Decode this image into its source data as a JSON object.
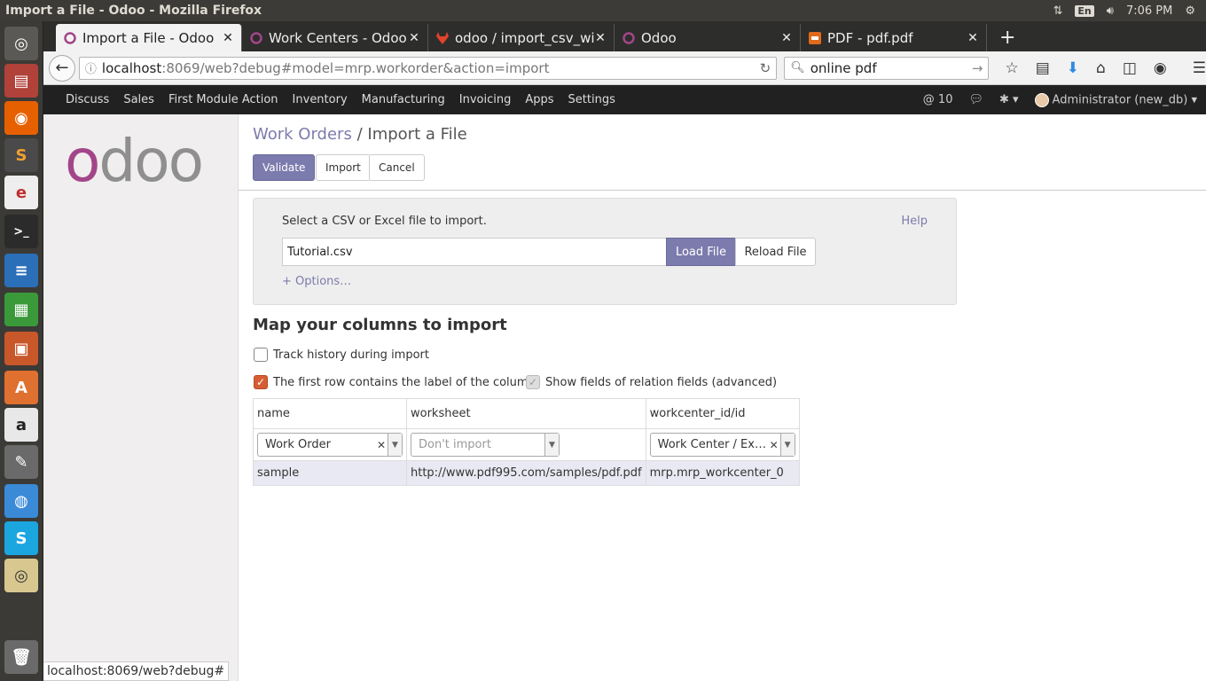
{
  "os": {
    "window_title": "Import a File - Odoo - Mozilla Firefox",
    "keyboard": "En",
    "clock": "7:06 PM"
  },
  "tabs": [
    {
      "label": "Import a File - Odoo",
      "active": true,
      "icon": "odoo-favicon"
    },
    {
      "label": "Work Centers - Odoo",
      "active": false,
      "icon": "odoo-favicon"
    },
    {
      "label": "odoo / import_csv_wit",
      "active": false,
      "icon": "gitlab-favicon"
    },
    {
      "label": "Odoo",
      "active": false,
      "icon": "odoo-favicon"
    },
    {
      "label": "PDF - pdf.pdf",
      "active": false,
      "icon": "pdf-favicon"
    }
  ],
  "nav": {
    "url_host": "localhost",
    "url_path": ":8069/web?debug#model=mrp.workorder&action=import",
    "search_value": "online pdf"
  },
  "menu": {
    "items": [
      "Discuss",
      "Sales",
      "First Module Action",
      "Inventory",
      "Manufacturing",
      "Invoicing",
      "Apps",
      "Settings"
    ],
    "messages_count": "10",
    "user": "Administrator (new_db)"
  },
  "logo_text": "odoo",
  "breadcrumb": {
    "parent": "Work Orders",
    "separator": "/",
    "current": "Import a File"
  },
  "buttons": {
    "validate": "Validate",
    "import": "Import",
    "cancel": "Cancel"
  },
  "import_box": {
    "label": "Select a CSV or Excel file to import.",
    "help": "Help",
    "file_value": "Tutorial.csv",
    "load": "Load File",
    "reload": "Reload File",
    "options": "+ Options…"
  },
  "mapping": {
    "title": "Map your columns to import",
    "track_history": {
      "label": "Track history during import",
      "checked": false
    },
    "first_row_label": {
      "label": "The first row contains the label of the column",
      "checked": true
    },
    "show_relation": {
      "label": "Show fields of relation fields (advanced)",
      "checked": true,
      "disabled": true
    },
    "columns": [
      {
        "header": "name",
        "field": "Work Order",
        "placeholder": false,
        "clearable": true,
        "sample": "sample"
      },
      {
        "header": "worksheet",
        "field": "Don't import",
        "placeholder": true,
        "clearable": false,
        "sample": "http://www.pdf995.com/samples/pdf.pdf"
      },
      {
        "header": "workcenter_id/id",
        "field": "Work Center / Ex…",
        "placeholder": false,
        "clearable": true,
        "sample": "mrp.mrp_workcenter_0"
      }
    ]
  },
  "status_bar": "localhost:8069/web?debug#"
}
